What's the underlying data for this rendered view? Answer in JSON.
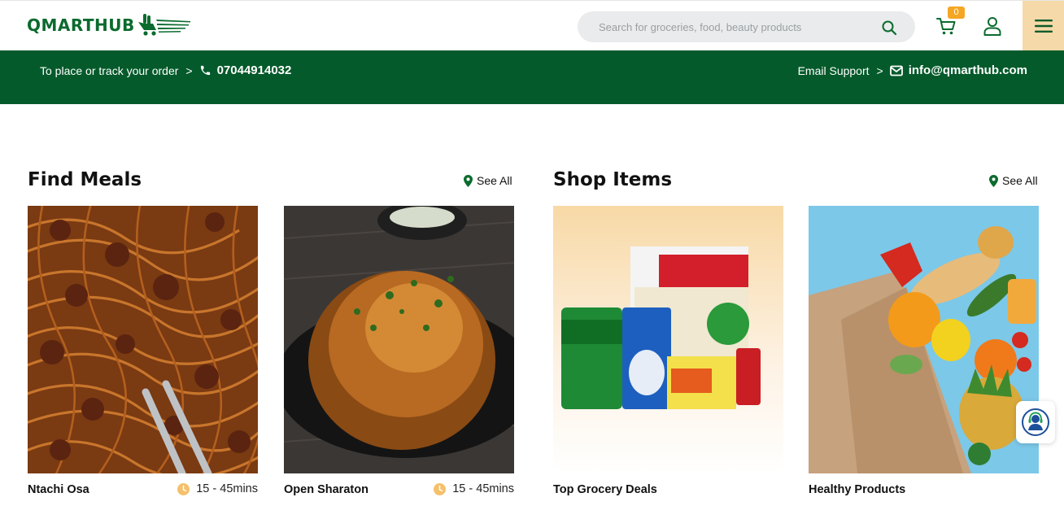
{
  "header": {
    "logo_text": "QMARTHUB",
    "search_placeholder": "Search for groceries, food, beauty products",
    "cart_count": "0",
    "icons": {
      "search": "search-icon",
      "cart": "cart-icon",
      "user": "user-icon",
      "menu": "hamburger-menu-icon"
    },
    "colors": {
      "brand_green": "#0b6b2e",
      "menu_bg": "#f6d9a8",
      "badge": "#f5a623"
    }
  },
  "contact_bar": {
    "order_label": "To place or track your order",
    "chevron": ">",
    "phone": "07044914032",
    "email_label": "Email Support",
    "email": "info@qmarthub.com",
    "background": "#045a2a"
  },
  "meals": {
    "title": "Find Meals",
    "see_all": "See All",
    "items": [
      {
        "name": "Ntachi Osa",
        "time": "15 - 45mins",
        "image": "spaghetti-bolognese-photo"
      },
      {
        "name": "Open Sharaton",
        "time": "15 - 45mins",
        "image": "roast-chicken-photo"
      }
    ]
  },
  "shop": {
    "title": "Shop Items",
    "see_all": "See All",
    "items": [
      {
        "name": "Top Grocery Deals",
        "image": "grocery-products-photo"
      },
      {
        "name": "Healthy Products",
        "image": "fresh-vegetables-bag-photo"
      }
    ]
  },
  "support_widget": {
    "icon": "customer-support-icon"
  }
}
